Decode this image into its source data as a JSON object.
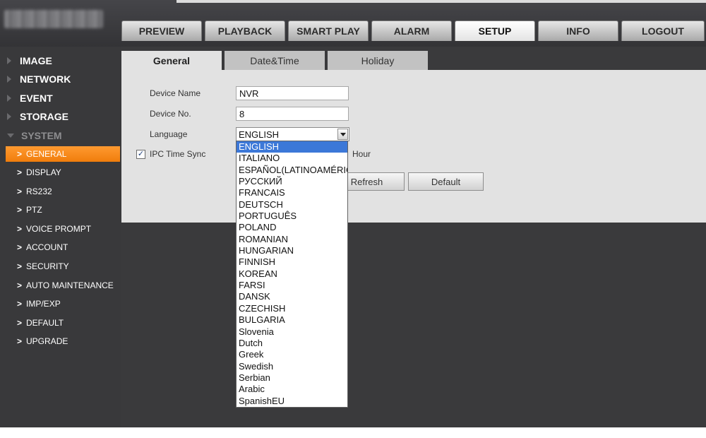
{
  "top_tabs": [
    "PREVIEW",
    "PLAYBACK",
    "SMART PLAY",
    "ALARM",
    "SETUP",
    "INFO",
    "LOGOUT"
  ],
  "sidebar": {
    "main": [
      "IMAGE",
      "NETWORK",
      "EVENT",
      "STORAGE",
      "SYSTEM"
    ],
    "sub": [
      "GENERAL",
      "DISPLAY",
      "RS232",
      "PTZ",
      "VOICE PROMPT",
      "ACCOUNT",
      "SECURITY",
      "AUTO MAINTENANCE",
      "IMP/EXP",
      "DEFAULT",
      "UPGRADE"
    ]
  },
  "sub_tabs": [
    "General",
    "Date&Time",
    "Holiday"
  ],
  "form": {
    "device_name_label": "Device Name",
    "device_name_value": "NVR",
    "device_no_label": "Device No.",
    "device_no_value": "8",
    "language_label": "Language",
    "language_value": "ENGLISH",
    "ipc_sync_label": "IPC Time Sync",
    "ipc_sync_unit": "Hour"
  },
  "buttons": {
    "refresh": "Refresh",
    "default": "Default"
  },
  "language_options": [
    "ENGLISH",
    "ITALIANO",
    "ESPAÑOL(LATINOAMÉRICA)",
    "РУССКИЙ",
    "FRANCAIS",
    "DEUTSCH",
    "PORTUGUÊS",
    "POLAND",
    "ROMANIAN",
    "HUNGARIAN",
    "FINNISH",
    "KOREAN",
    "FARSI",
    "DANSK",
    "CZECHISH",
    "BULGARIA",
    "Slovenia",
    "Dutch",
    "Greek",
    "Swedish",
    "Serbian",
    "Arabic",
    "SpanishEU"
  ],
  "colors": {
    "accent": "#f5871a",
    "selection": "#3c78d8",
    "sidebar_bg": "#39393b",
    "panel_bg": "#e2e2e2"
  }
}
